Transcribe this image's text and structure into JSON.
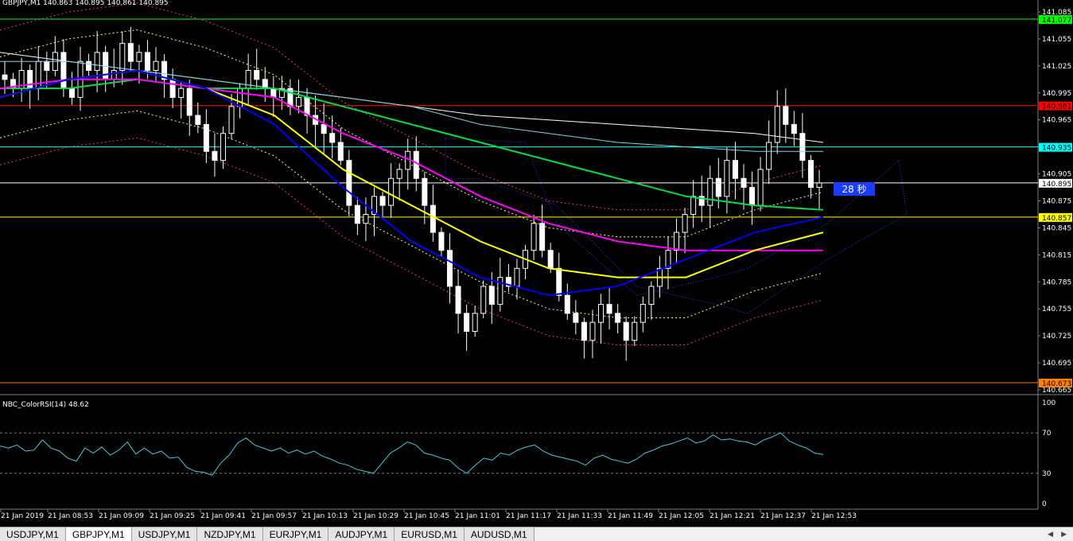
{
  "window": {
    "symbol_header": "GBPJPY,M1  140.863 140.895 140.861 140.895",
    "indicator_header": "NBC_ColorRSI(14) 48.62",
    "countdown": "28 秒"
  },
  "price_axis": {
    "ticks": [
      "141.085",
      "141.055",
      "141.025",
      "140.995",
      "140.965",
      "140.935",
      "140.905",
      "140.875",
      "140.845",
      "140.815",
      "140.785",
      "140.755",
      "140.725",
      "140.695",
      "140.665"
    ],
    "markers": [
      {
        "label": "141.077",
        "color": "#00ff00",
        "text_color": "#000000"
      },
      {
        "label": "140.981",
        "color": "#ff0000",
        "text_color": "#000000"
      },
      {
        "label": "140.935",
        "color": "#00ffff",
        "text_color": "#000000"
      },
      {
        "label": "140.895",
        "color": "#ffffff",
        "text_color": "#000000"
      },
      {
        "label": "140.857",
        "color": "#ffff00",
        "text_color": "#000000"
      },
      {
        "label": "140.673",
        "color": "#ff8000",
        "text_color": "#000000"
      }
    ]
  },
  "rsi_axis": {
    "ticks": [
      "100",
      "70",
      "30",
      "0"
    ]
  },
  "time_axis": {
    "labels": [
      "21 Jan 2019",
      "21 Jan 08:53",
      "21 Jan 09:09",
      "21 Jan 09:25",
      "21 Jan 09:41",
      "21 Jan 09:57",
      "21 Jan 10:13",
      "21 Jan 10:29",
      "21 Jan 10:45",
      "21 Jan 11:01",
      "21 Jan 11:17",
      "21 Jan 11:33",
      "21 Jan 11:49",
      "21 Jan 12:05",
      "21 Jan 12:21",
      "21 Jan 12:37",
      "21 Jan 12:53"
    ]
  },
  "tabs": [
    {
      "label": "USDJPY,M1",
      "active": false
    },
    {
      "label": "GBPJPY,M1",
      "active": true
    },
    {
      "label": "USDJPY,M1",
      "active": false
    },
    {
      "label": "NZDJPY,M1",
      "active": false
    },
    {
      "label": "EURJPY,M1",
      "active": false
    },
    {
      "label": "AUDJPY,M1",
      "active": false
    },
    {
      "label": "EURUSD,M1",
      "active": false
    },
    {
      "label": "AUDUSD,M1",
      "active": false
    }
  ],
  "chart_data": [
    {
      "type": "candlestick",
      "symbol": "GBPJPY",
      "timeframe": "M1",
      "last": {
        "open": 140.863,
        "high": 140.895,
        "low": 140.861,
        "close": 140.895
      },
      "ylim": [
        140.665,
        141.085
      ],
      "horizontal_levels": [
        141.077,
        140.981,
        140.935,
        140.895,
        140.857,
        140.673
      ],
      "close_series": [
        141.01,
        141.0,
        141.02,
        141.0,
        141.03,
        141.02,
        141.04,
        141.0,
        140.99,
        141.03,
        141.02,
        141.04,
        141.01,
        141.02,
        141.05,
        141.03,
        141.04,
        141.02,
        141.03,
        141.01,
        140.99,
        141.0,
        140.97,
        140.96,
        140.93,
        140.92,
        140.95,
        140.98,
        141.0,
        141.02,
        141.01,
        141.0,
        140.99,
        141.0,
        140.98,
        140.99,
        140.97,
        140.96,
        140.95,
        140.94,
        140.92,
        140.87,
        140.85,
        140.86,
        140.88,
        140.87,
        140.9,
        140.91,
        140.93,
        140.9,
        140.87,
        140.84,
        140.82,
        140.78,
        140.75,
        140.73,
        140.75,
        140.78,
        140.76,
        140.79,
        140.78,
        140.8,
        140.82,
        140.85,
        140.82,
        140.8,
        140.77,
        140.75,
        140.74,
        140.72,
        140.74,
        140.76,
        140.75,
        140.74,
        140.72,
        140.74,
        140.76,
        140.78,
        140.8,
        140.82,
        140.84,
        140.86,
        140.88,
        140.87,
        140.9,
        140.88,
        140.92,
        140.9,
        140.89,
        140.87,
        140.91,
        140.94,
        140.98,
        140.96,
        140.95,
        140.92,
        140.89,
        140.895
      ],
      "moving_averages": [
        {
          "color": "#ffffff",
          "values": [
            141.04,
            141.03,
            141.02,
            141.01,
            141.0,
            140.99,
            140.98,
            140.97,
            140.965,
            140.96,
            140.955,
            140.95,
            140.94
          ]
        },
        {
          "color": "#7ad7e0",
          "values": [
            141.03,
            141.03,
            141.02,
            141.01,
            141.0,
            140.99,
            140.98,
            140.96,
            140.95,
            140.94,
            140.935,
            140.93,
            140.93
          ]
        },
        {
          "color": "#00e040",
          "values": [
            141.0,
            141.0,
            141.01,
            141.0,
            141.0,
            140.98,
            140.96,
            140.94,
            140.92,
            140.9,
            140.88,
            140.87,
            140.865
          ]
        },
        {
          "color": "#ff00ff",
          "values": [
            141.0,
            141.01,
            141.01,
            141.0,
            140.99,
            140.95,
            140.92,
            140.88,
            140.85,
            140.83,
            140.82,
            140.82,
            140.82
          ]
        },
        {
          "color": "#ffff00",
          "values": [
            140.99,
            141.01,
            141.02,
            141.0,
            140.97,
            140.91,
            140.87,
            140.83,
            140.8,
            140.79,
            140.79,
            140.82,
            140.84
          ]
        },
        {
          "color": "#0000ff",
          "values": [
            140.99,
            141.01,
            141.02,
            141.0,
            140.96,
            140.89,
            140.83,
            140.79,
            140.77,
            140.78,
            140.81,
            140.84,
            140.857
          ]
        }
      ]
    },
    {
      "type": "line",
      "title": "NBC_ColorRSI(14) 48.62",
      "ylim": [
        0,
        100
      ],
      "levels": [
        70,
        30
      ],
      "values": [
        57,
        55,
        58,
        52,
        53,
        63,
        55,
        52,
        45,
        42,
        55,
        50,
        56,
        48,
        53,
        61,
        49,
        55,
        49,
        52,
        45,
        46,
        36,
        32,
        31,
        28,
        40,
        48,
        60,
        65,
        58,
        55,
        52,
        55,
        50,
        53,
        49,
        52,
        47,
        44,
        40,
        38,
        34,
        32,
        30,
        40,
        50,
        55,
        61,
        58,
        50,
        48,
        45,
        43,
        35,
        30,
        38,
        45,
        43,
        50,
        48,
        53,
        56,
        58,
        52,
        48,
        46,
        44,
        42,
        38,
        45,
        48,
        44,
        42,
        40,
        44,
        50,
        53,
        57,
        59,
        62,
        65,
        60,
        62,
        68,
        63,
        64,
        62,
        61,
        58,
        63,
        66,
        70,
        62,
        58,
        55,
        50,
        48.62
      ]
    }
  ]
}
